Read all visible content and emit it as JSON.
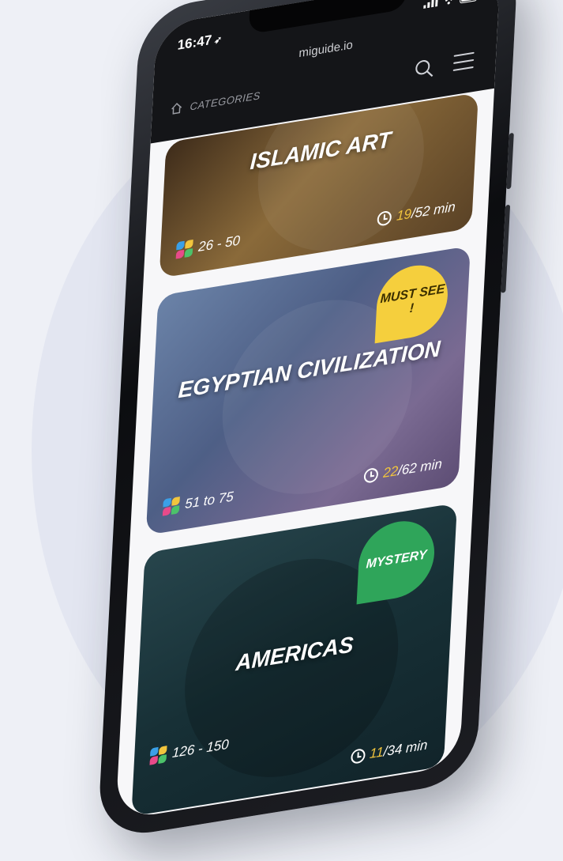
{
  "status_bar": {
    "time": "16:47",
    "location_arrow": "➶"
  },
  "browser": {
    "url": "miguide.io"
  },
  "nav": {
    "label": "CATEGORIES"
  },
  "cards": [
    {
      "title": "ISLAMIC ART",
      "range": "26 - 50",
      "duration_current": "19",
      "duration_rest": "/52 min",
      "badge": ""
    },
    {
      "title": "EGYPTIAN CIVILIZATION",
      "range": "51 to 75",
      "duration_current": "22",
      "duration_rest": "/62 min",
      "badge": "MUST SEE !"
    },
    {
      "title": "AMERICAS",
      "range": "126 - 150",
      "duration_current": "11",
      "duration_rest": "/34 min",
      "badge": "MYSTERY"
    }
  ],
  "colors": {
    "accent_yellow": "#f5cf3d",
    "accent_green": "#2fa55a",
    "duration_highlight": "#f2c53d"
  },
  "icons": {
    "home": "home-icon",
    "search": "search-icon",
    "menu": "menu-icon",
    "range": "petal-icon",
    "clock": "clock-icon"
  }
}
